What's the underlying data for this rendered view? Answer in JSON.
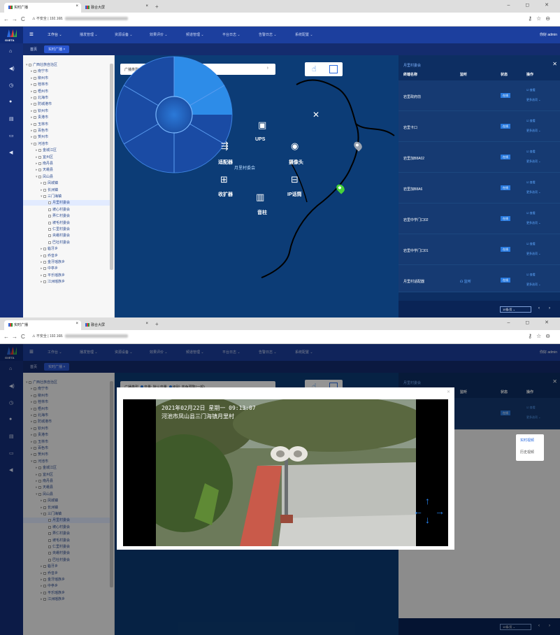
{
  "browser": {
    "tabs": [
      {
        "label": "实时广播"
      },
      {
        "label": "融合大屏"
      }
    ],
    "insecure_label": "不安全",
    "url_prefix": "192.168.",
    "win_controls": "–  ◻  ✕"
  },
  "app": {
    "brand": "GXETA",
    "menus": [
      "工作台",
      "播发管理",
      "资源设备",
      "效果评价",
      "频道管理",
      "平台日志",
      "告警日志",
      "系统配置"
    ],
    "user_greeting": "你好 admin",
    "page_tabs": [
      {
        "label": "首页"
      },
      {
        "label": "实时广播"
      }
    ]
  },
  "tree": {
    "items": [
      {
        "label": "广西壮族自治区",
        "depth": 0,
        "arrow": "▾"
      },
      {
        "label": "南宁市",
        "depth": 1,
        "arrow": "▸"
      },
      {
        "label": "柳州市",
        "depth": 1,
        "arrow": "▸"
      },
      {
        "label": "桂林市",
        "depth": 1,
        "arrow": "▸"
      },
      {
        "label": "梧州市",
        "depth": 1,
        "arrow": "▸"
      },
      {
        "label": "北海市",
        "depth": 1,
        "arrow": "▸"
      },
      {
        "label": "防城港市",
        "depth": 1,
        "arrow": "▸"
      },
      {
        "label": "钦州市",
        "depth": 1,
        "arrow": "▸"
      },
      {
        "label": "贵港市",
        "depth": 1,
        "arrow": "▸"
      },
      {
        "label": "玉林市",
        "depth": 1,
        "arrow": "▸"
      },
      {
        "label": "百色市",
        "depth": 1,
        "arrow": "▸"
      },
      {
        "label": "贺州市",
        "depth": 1,
        "arrow": "▸"
      },
      {
        "label": "河池市",
        "depth": 1,
        "arrow": "▾"
      },
      {
        "label": "金城江区",
        "depth": 2,
        "arrow": "▸"
      },
      {
        "label": "宜州区",
        "depth": 2,
        "arrow": "▸"
      },
      {
        "label": "南丹县",
        "depth": 2,
        "arrow": "▸"
      },
      {
        "label": "天峨县",
        "depth": 2,
        "arrow": "▸"
      },
      {
        "label": "凤山县",
        "depth": 2,
        "arrow": "▾"
      },
      {
        "label": "凤城镇",
        "depth": 3,
        "arrow": "▸"
      },
      {
        "label": "长洲镇",
        "depth": 3,
        "arrow": "▸"
      },
      {
        "label": "三门海镇",
        "depth": 3,
        "arrow": "▾"
      },
      {
        "label": "月里村委会",
        "depth": 4,
        "arrow": "",
        "selected": true
      },
      {
        "label": "坡心村委会",
        "depth": 4,
        "arrow": ""
      },
      {
        "label": "弄仁村委会",
        "depth": 4,
        "arrow": ""
      },
      {
        "label": "坡毛村委会",
        "depth": 4,
        "arrow": ""
      },
      {
        "label": "仁里村委会",
        "depth": 4,
        "arrow": ""
      },
      {
        "label": "央峨村委会",
        "depth": 4,
        "arrow": ""
      },
      {
        "label": "巴社村委会",
        "depth": 4,
        "arrow": ""
      },
      {
        "label": "砦牙乡",
        "depth": 3,
        "arrow": "▸"
      },
      {
        "label": "乔音乡",
        "depth": 3,
        "arrow": "▸"
      },
      {
        "label": "金牙瑶族乡",
        "depth": 3,
        "arrow": "▸"
      },
      {
        "label": "中亭乡",
        "depth": 3,
        "arrow": "▸"
      },
      {
        "label": "平乐瑶族乡",
        "depth": 3,
        "arrow": "▸"
      },
      {
        "label": "江洲瑶族乡",
        "depth": 3,
        "arrow": "▸"
      }
    ]
  },
  "map": {
    "legend_type": "广播类型",
    "legend_items": [
      "音量: 默认音量",
      "级别: 蓝色预警(一般)"
    ],
    "close_x": "✕"
  },
  "radial": {
    "center": "月里村委会",
    "items": [
      {
        "key": "ups",
        "label": "UPS",
        "icon": "battery-icon",
        "glyph": "🔋"
      },
      {
        "key": "camera",
        "label": "摄像头",
        "icon": "camera-icon",
        "glyph": "📷"
      },
      {
        "key": "ip_talk",
        "label": "IP话筒",
        "icon": "microphone-icon",
        "glyph": "🎙"
      },
      {
        "key": "speaker",
        "label": "音柱",
        "icon": "speaker-column-icon",
        "glyph": "▮"
      },
      {
        "key": "receiver",
        "label": "收扩器",
        "icon": "receiver-icon",
        "glyph": "📻"
      },
      {
        "key": "adapter",
        "label": "适配器",
        "icon": "adapter-icon",
        "glyph": "⇶"
      }
    ]
  },
  "panel": {
    "title": "月里村委会",
    "columns": [
      "终端名称",
      "监听",
      "状态",
      "操作"
    ],
    "rows": [
      {
        "name": "岩里政府前",
        "monitor": "",
        "status": "在线",
        "op_view": "☑ 查看",
        "op_more": "更多选项 ⌄"
      },
      {
        "name": "岩里卡口",
        "monitor": "",
        "status": "在线",
        "op_view": "☑ 查看",
        "op_more": "更多选项 ⌄"
      },
      {
        "name": "岩里加B8A02",
        "monitor": "",
        "status": "在线",
        "op_view": "☑ 查看",
        "op_more": "更多选项 ⌄"
      },
      {
        "name": "岩里加B8A6",
        "monitor": "",
        "status": "在线",
        "op_view": "☑ 查看",
        "op_more": "更多选项 ⌄"
      },
      {
        "name": "岩里中学门口02",
        "monitor": "",
        "status": "在线",
        "op_view": "☑ 查看",
        "op_more": "更多选项 ⌄"
      },
      {
        "name": "岩里中学门口01",
        "monitor": "",
        "status": "在线",
        "op_view": "☑ 查看",
        "op_more": "更多选项 ⌄"
      },
      {
        "name": "月里村适配器",
        "monitor": "☊ 监听",
        "status": "在线",
        "op_view": "☑ 查看",
        "op_more": "更多选项 ⌄"
      }
    ],
    "page_size": "10条/页",
    "prev": "‹",
    "next": "›"
  },
  "dropdown": {
    "items": [
      "实时视频",
      "历史视频"
    ]
  },
  "video": {
    "timestamp": "2021年02月22日  星期一  09:13:07",
    "location": "河池市凤山县三门海镇月里村",
    "close": "✕"
  },
  "colors": {
    "topbar": "#1c3f9e",
    "map": "#0c3c76",
    "panel": "#0d2e62",
    "accent": "#2a7be0"
  }
}
